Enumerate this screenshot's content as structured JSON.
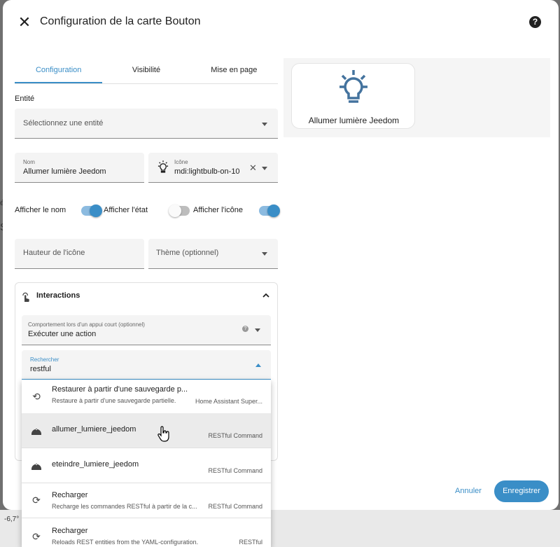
{
  "background": {
    "left_char": "é",
    "left_char2": "S",
    "bottom_left": "-6,7°"
  },
  "header": {
    "close_icon": "close-icon",
    "title": "Configuration de la carte Bouton",
    "help_icon": "help-icon"
  },
  "tabs": [
    {
      "label": "Configuration"
    },
    {
      "label": "Visibilité"
    },
    {
      "label": "Mise en page"
    }
  ],
  "entity": {
    "label": "Entité",
    "placeholder": "Sélectionnez une entité"
  },
  "name_field": {
    "label": "Nom",
    "value": "Allumer lumière Jeedom"
  },
  "icon_field": {
    "label": "Icône",
    "value": "mdi:lightbulb-on-10"
  },
  "toggles": [
    {
      "label": "Afficher le nom",
      "on": true
    },
    {
      "label": "Afficher l'état",
      "on": false
    },
    {
      "label": "Afficher l'icône",
      "on": true
    }
  ],
  "icon_height": {
    "placeholder": "Hauteur de l'icône"
  },
  "theme": {
    "placeholder": "Thème (optionnel)"
  },
  "interactions": {
    "title": "Interactions",
    "tap_action": {
      "label": "Comportement lors d'un appui court (optionnel)",
      "value": "Exécuter une action"
    },
    "search": {
      "label": "Rechercher",
      "value": "restful"
    }
  },
  "dropdown_options": [
    {
      "title": "Restaurer à partir d'une sauvegarde p...",
      "subtitle": "Restaure à partir d'une sauvegarde partielle.",
      "source": "Home Assistant Super...",
      "icon": "restore-icon"
    },
    {
      "title": "allumer_lumiere_jeedom",
      "subtitle": "",
      "source": "RESTful Command",
      "icon": "bell-icon"
    },
    {
      "title": "eteindre_lumiere_jeedom",
      "subtitle": "",
      "source": "RESTful Command",
      "icon": "bell-icon"
    },
    {
      "title": "Recharger",
      "subtitle": "Recharge les commandes RESTful à partir de la c...",
      "source": "RESTful Command",
      "icon": "reload-icon"
    },
    {
      "title": "Recharger",
      "subtitle": "Reloads REST entities from the YAML-configuration.",
      "source": "RESTful",
      "icon": "reload-icon"
    }
  ],
  "preview": {
    "name": "Allumer lumière Jeedom",
    "icon": "lightbulb-on-icon"
  },
  "footer": {
    "cancel": "Annuler",
    "save": "Enregistrer"
  },
  "colors": {
    "accent": "#3a8ec7",
    "icon_blue": "#44739e"
  }
}
